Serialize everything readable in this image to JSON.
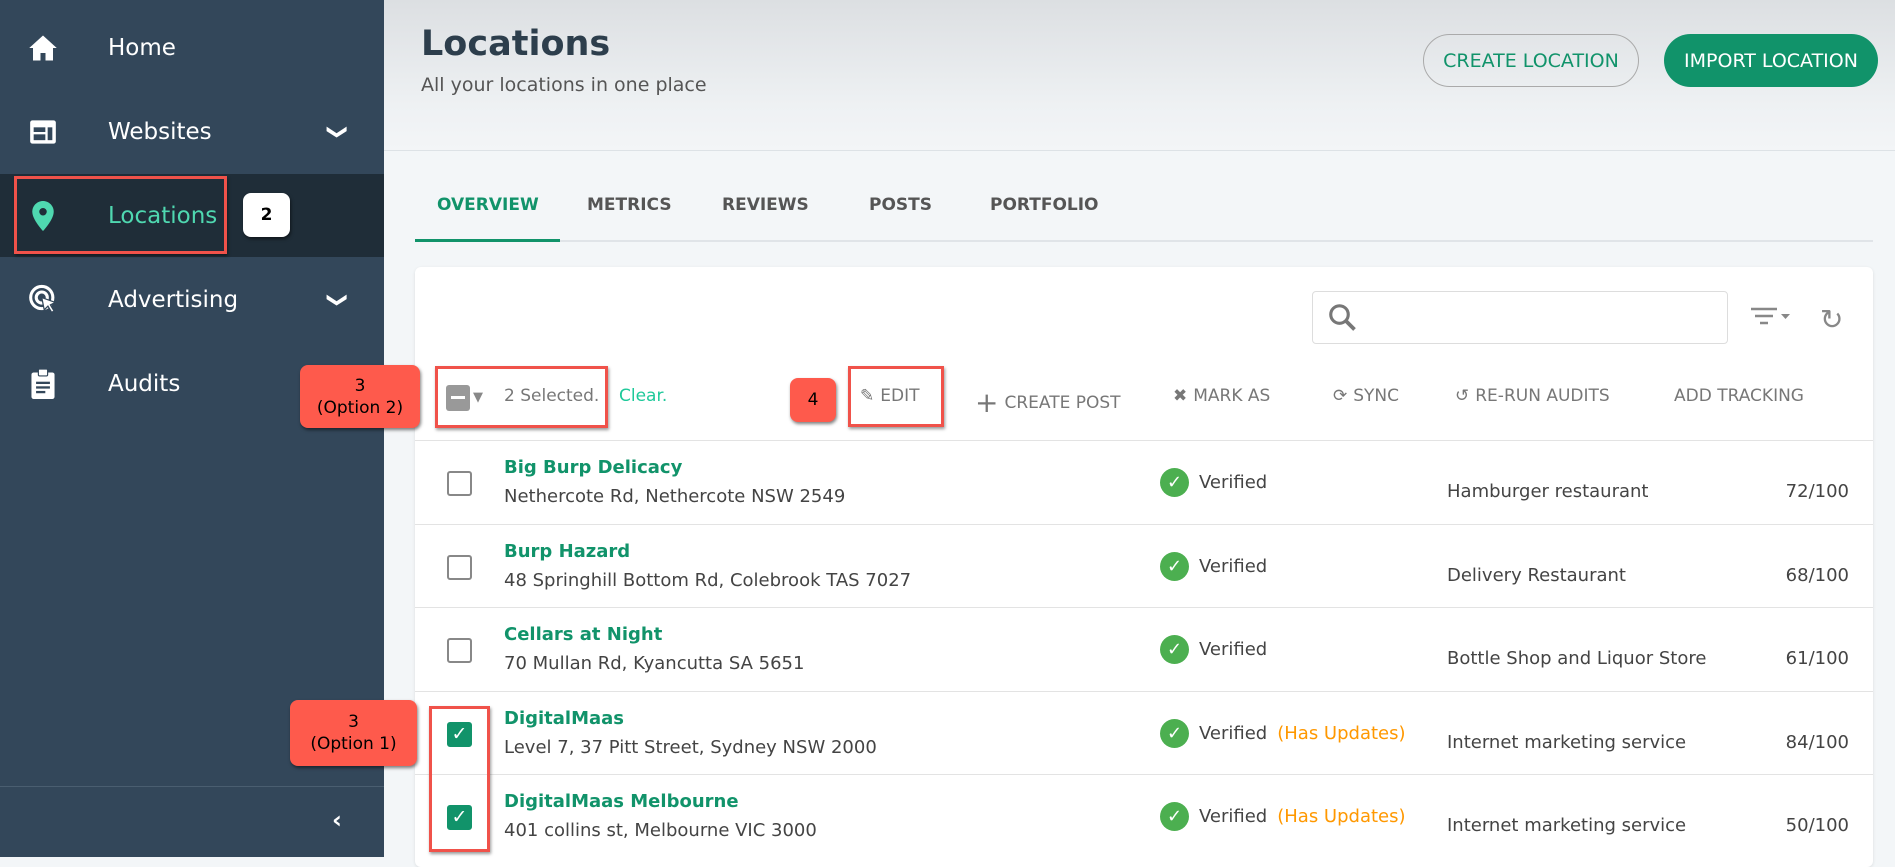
{
  "sidebar": {
    "items": [
      {
        "label": "Home",
        "icon": "home-icon"
      },
      {
        "label": "Websites",
        "icon": "website-icon",
        "expandable": true
      },
      {
        "label": "Locations",
        "icon": "location-pin-icon",
        "active": true
      },
      {
        "label": "Advertising",
        "icon": "ad-click-icon",
        "expandable": true
      },
      {
        "label": "Audits",
        "icon": "clipboard-icon"
      }
    ],
    "collapse_icon": "chevron-left-icon"
  },
  "header": {
    "title": "Locations",
    "subtitle": "All your locations in one place",
    "create_label": "CREATE LOCATION",
    "import_label": "IMPORT LOCATION"
  },
  "tabs": [
    {
      "label": "OVERVIEW",
      "active": true
    },
    {
      "label": "METRICS"
    },
    {
      "label": "REVIEWS"
    },
    {
      "label": "POSTS"
    },
    {
      "label": "PORTFOLIO"
    }
  ],
  "search": {
    "placeholder": ""
  },
  "toolbar": {
    "selected": "2 Selected.",
    "clear": "Clear.",
    "edit": "EDIT",
    "create_post": "CREATE POST",
    "mark_as": "MARK AS",
    "sync": "SYNC",
    "rerun": "RE-RUN AUDITS",
    "tracking": "ADD TRACKING"
  },
  "rows": [
    {
      "name": "Big Burp Delicacy",
      "address": "Nethercote Rd, Nethercote NSW 2549",
      "status": "Verified",
      "updates": "",
      "category": "Hamburger restaurant",
      "score": "72/100",
      "checked": false
    },
    {
      "name": "Burp Hazard",
      "address": "48 Springhill Bottom Rd, Colebrook TAS 7027",
      "status": "Verified",
      "updates": "",
      "category": "Delivery Restaurant",
      "score": "68/100",
      "checked": false
    },
    {
      "name": "Cellars at Night",
      "address": "70 Mullan Rd, Kyancutta SA 5651",
      "status": "Verified",
      "updates": "",
      "category": "Bottle Shop and Liquor Store",
      "score": "61/100",
      "checked": false
    },
    {
      "name": "DigitalMaas",
      "address": "Level 7, 37 Pitt Street, Sydney NSW 2000",
      "status": "Verified",
      "updates": "(Has Updates)",
      "category": "Internet marketing service",
      "score": "84/100",
      "checked": true
    },
    {
      "name": "DigitalMaas Melbourne",
      "address": "401 collins st, Melbourne VIC 3000",
      "status": "Verified",
      "updates": "(Has Updates)",
      "category": "Internet marketing service",
      "score": "50/100",
      "checked": true
    }
  ],
  "annotations": {
    "step2": "2",
    "step3a": "3",
    "step3a_sub": "(Option 2)",
    "step3b": "3",
    "step3b_sub": "(Option 1)",
    "step4": "4"
  },
  "colors": {
    "accent": "#11936a",
    "sidebar": "#33475a",
    "active_nav": "#4fd8b0",
    "updates": "#ff9800",
    "annotation": "#f0524a"
  }
}
